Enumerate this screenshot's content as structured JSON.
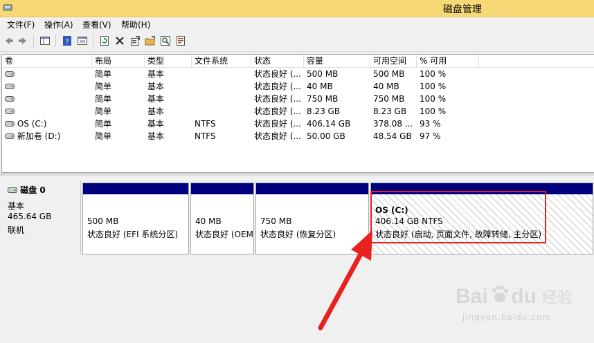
{
  "window": {
    "title": "磁盘管理"
  },
  "menu": [
    "文件(F)",
    "操作(A)",
    "查看(V)",
    "帮助(H)"
  ],
  "toolbar": [
    "back-icon",
    "forward-icon",
    "console-tree-icon",
    "help-icon",
    "properties-icon",
    "refresh-icon",
    "delete-icon",
    "settings-icon",
    "open-icon",
    "search-icon",
    "export-icon"
  ],
  "columns": [
    "卷",
    "布局",
    "类型",
    "文件系统",
    "状态",
    "容量",
    "可用空间",
    "% 可用"
  ],
  "volumes": [
    {
      "name": "",
      "layout": "简单",
      "type": "基本",
      "fs": "",
      "status": "状态良好 (...",
      "capacity": "500 MB",
      "free": "500 MB",
      "pct": "100 %"
    },
    {
      "name": "",
      "layout": "简单",
      "type": "基本",
      "fs": "",
      "status": "状态良好 (...",
      "capacity": "40 MB",
      "free": "40 MB",
      "pct": "100 %"
    },
    {
      "name": "",
      "layout": "简单",
      "type": "基本",
      "fs": "",
      "status": "状态良好 (...",
      "capacity": "750 MB",
      "free": "750 MB",
      "pct": "100 %"
    },
    {
      "name": "",
      "layout": "简单",
      "type": "基本",
      "fs": "",
      "status": "状态良好 (...",
      "capacity": "8.23 GB",
      "free": "8.23 GB",
      "pct": "100 %"
    },
    {
      "name": "OS (C:)",
      "layout": "简单",
      "type": "基本",
      "fs": "NTFS",
      "status": "状态良好 (...",
      "capacity": "406.14 GB",
      "free": "378.08 ...",
      "pct": "93 %"
    },
    {
      "name": "新加卷 (D:)",
      "layout": "简单",
      "type": "基本",
      "fs": "NTFS",
      "status": "状态良好 (...",
      "capacity": "50.00 GB",
      "free": "48.54 GB",
      "pct": "97 %"
    }
  ],
  "disk": {
    "name": "磁盘 0",
    "type": "基本",
    "size": "465.64 GB",
    "state": "联机"
  },
  "partitions": [
    {
      "title": "",
      "size": "500 MB",
      "status": "状态良好 (EFI 系统分区)"
    },
    {
      "title": "",
      "size": "40 MB",
      "status": "状态良好 (OEM"
    },
    {
      "title": "",
      "size": "750 MB",
      "status": "状态良好 (恢复分区)"
    },
    {
      "title": "OS  (C:)",
      "size": "406.14 GB NTFS",
      "status": "状态良好 (启动, 页面文件, 故障转储, 主分区)"
    }
  ],
  "watermark": {
    "brand": "Bai",
    "brand2": "du",
    "cn": "经验",
    "url": "jingyan.baidu.com"
  },
  "colors": {
    "titlebar": "#f6d876",
    "partition_bar": "#00007f",
    "highlight": "#e8211f"
  }
}
